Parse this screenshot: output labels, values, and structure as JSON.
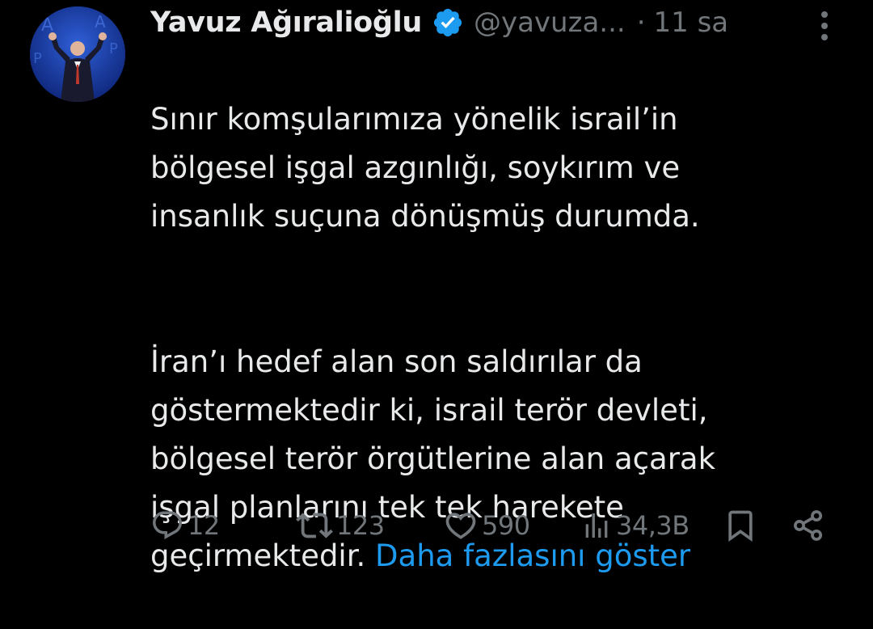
{
  "tweet": {
    "display_name": "Yavuz Ağıralioğlu",
    "handle": "@yavuza...",
    "separator": "·",
    "time": "11 sa",
    "paragraph1": "Sınır komşularımıza yönelik israil’in\nbölgesel işgal azgınlığı, soykırım ve\ninsanlık suçuna dönüşmüş durumda.",
    "paragraph2": "İran’ı hedef alan son saldırılar da\ngöstermektedir ki, israil terör devleti,\nbölgesel terör örgütlerine alan açarak\nişgal planlarını tek tek harekete\ngeçirmektedir. ",
    "show_more": "Daha fazlasını göster"
  },
  "actions": {
    "replies": "12",
    "reposts": "123",
    "likes": "590",
    "views": "34,3B"
  },
  "icons": {
    "verified": "verified-badge-icon",
    "more": "more-vertical-icon",
    "reply": "reply-icon",
    "repost": "repost-icon",
    "like": "heart-icon",
    "views": "views-icon",
    "bookmark": "bookmark-icon",
    "share": "share-icon"
  },
  "colors": {
    "background": "#000000",
    "text": "#e7e9ea",
    "muted": "#71767b",
    "link": "#1d9bf0",
    "verified": "#1d9bf0"
  }
}
